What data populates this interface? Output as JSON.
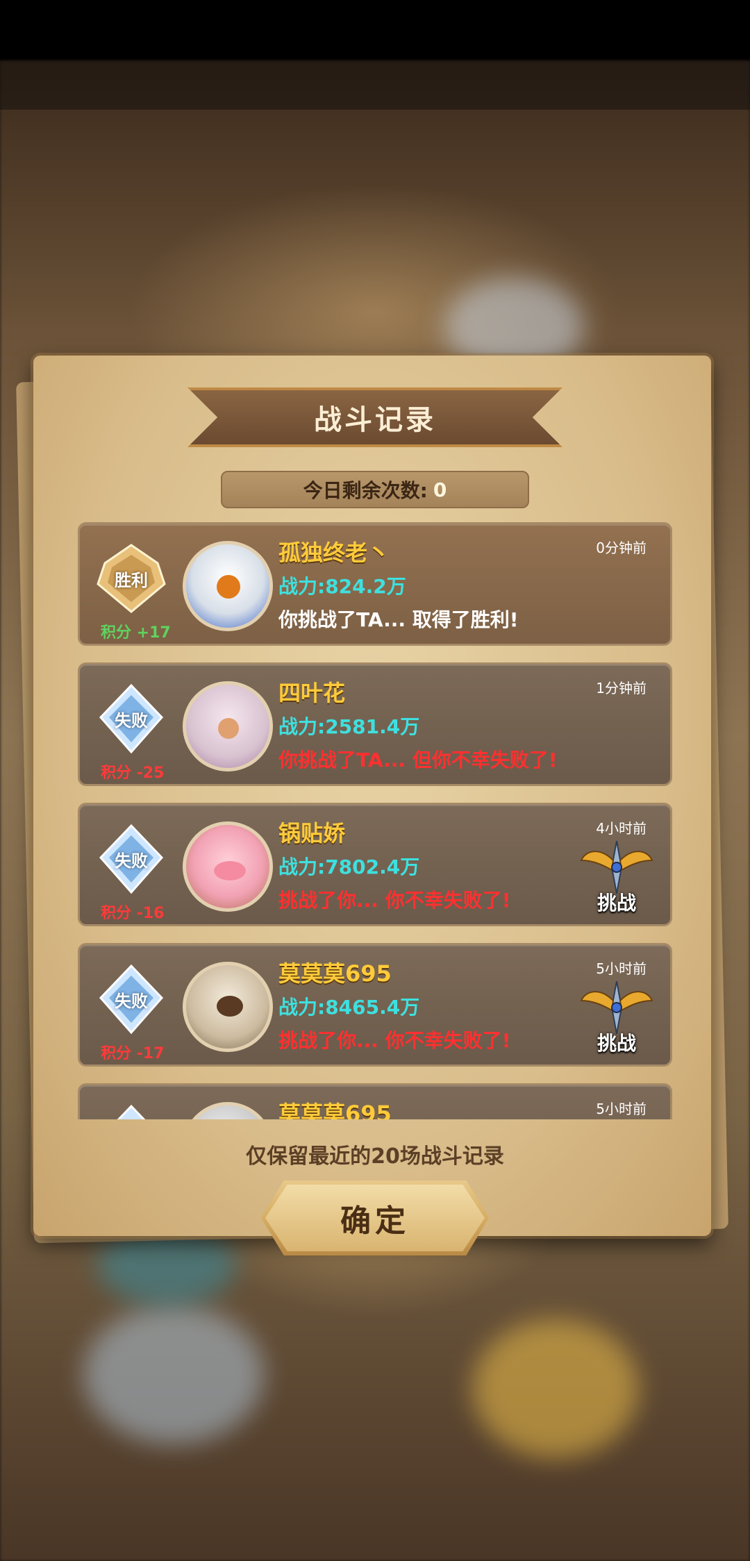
{
  "dialog": {
    "title": "战斗记录",
    "remaining_label": "今日剩余次数:",
    "remaining_count": "0",
    "footer_note": "仅保留最近的20场战斗记录",
    "confirm_label": "确定"
  },
  "records": [
    {
      "outcome": "win",
      "badge": "胜利",
      "score": "积分 +17",
      "name": "孤独终老丶",
      "power": "战力:824.2万",
      "message": "你挑战了TA... 取得了胜利!",
      "time": "0分钟前",
      "challenge_label": ""
    },
    {
      "outcome": "lose",
      "badge": "失败",
      "score": "积分 -25",
      "name": "四叶花",
      "power": "战力:2581.4万",
      "message": "你挑战了TA... 但你不幸失败了!",
      "time": "1分钟前",
      "challenge_label": ""
    },
    {
      "outcome": "lose",
      "badge": "失败",
      "score": "积分 -16",
      "name": "锅贴娇",
      "power": "战力:7802.4万",
      "message": "挑战了你... 你不幸失败了!",
      "time": "4小时前",
      "challenge_label": "挑战"
    },
    {
      "outcome": "lose",
      "badge": "失败",
      "score": "积分 -17",
      "name": "莫莫莫695",
      "power": "战力:8465.4万",
      "message": "挑战了你... 你不幸失败了!",
      "time": "5小时前",
      "challenge_label": "挑战"
    },
    {
      "outcome": "lose",
      "badge": "",
      "score": "",
      "name": "莫莫莫695",
      "power": "",
      "message": "",
      "time": "5小时前",
      "challenge_label": ""
    }
  ],
  "colors": {
    "win_score": "#5fd25f",
    "lose_score": "#ff3a3a",
    "name": "#ffcb3a",
    "power": "#3ee0df",
    "lose_message": "#ff3030"
  },
  "icons": {
    "win_badge": "gold-crest-icon",
    "lose_badge": "ice-crest-icon",
    "challenge": "winged-sword-icon"
  }
}
